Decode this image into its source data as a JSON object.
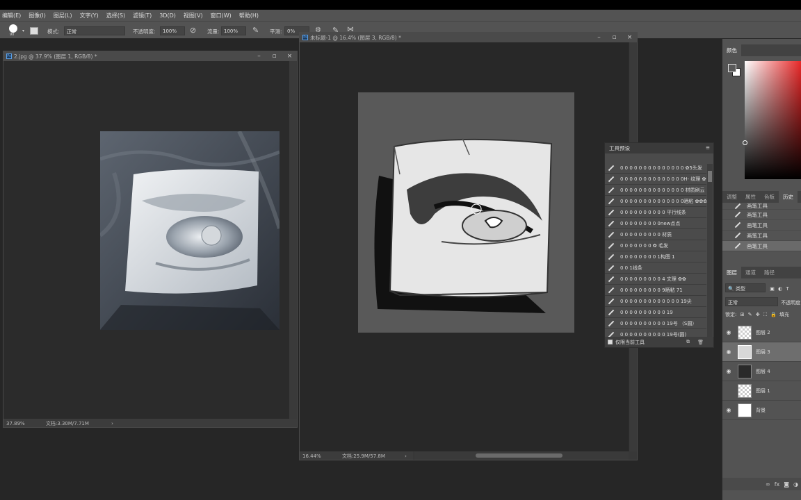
{
  "menu": [
    "编辑(E)",
    "图像(I)",
    "图层(L)",
    "文字(Y)",
    "选择(S)",
    "滤镜(T)",
    "3D(D)",
    "视图(V)",
    "窗口(W)",
    "帮助(H)"
  ],
  "options": {
    "brush_size": "90",
    "mode_label": "模式:",
    "mode_value": "正常",
    "opacity_label": "不透明度:",
    "opacity_value": "100%",
    "flow_label": "流量:",
    "flow_value": "100%",
    "smooth_label": "平滑:",
    "smooth_value": "0%"
  },
  "doc1": {
    "title": "2.jpg @ 37.9% (图层 1, RGB/8) *",
    "zoom": "37.89%",
    "docinfo": "文档:3.30M/7.71M"
  },
  "doc2": {
    "title": "未标题-1 @ 16.4% (图层 3, RGB/8) *",
    "zoom": "16.44%",
    "docinfo": "文档:25.9M/57.8M"
  },
  "presets": {
    "title": "工具预设",
    "items": [
      "0 0 0 0 0 0 0 0 0 0 0 0 0 0 ✿5头发",
      "0 0 0 0 0 0 0 0 0 0 0 0 0 0H- 纹理 ✿✿✿",
      "0 0 0 0 0 0 0 0 0 0 0 0 0 0 材质刷云",
      "0 0 0 0 0 0 0 0 0 0 0 0 0 0晒粘 ✿✿✿✿",
      "0 0 0 0 0 0 0 0 0 0 平行线条",
      "0 0 0 0 0 0 0 0 0new点点",
      "0 0 0 0 0 0 0 0 0 材质",
      "0 0 0 0 0 0 0 ✿ 毛发",
      "0 0 0 0 0 0 0 0 1构图 1",
      "0 0 1线条",
      "0 0 0 0 0 0 0 0 0 4 文理 ✿✿",
      "0 0 0 0 0 0 0 0 0 9晒粘 71",
      "0 0 0 0 0 0 0 0 0 0 0 0 0 19尖",
      "0 0 0 0 0 0 0 0 0 0 19",
      "0 0 0 0 0 0 0 0 0 0 19号 （S圆）",
      "0 0 0 0 0 0 0 0 0 0 19号(圆)"
    ],
    "footer": "仅限当前工具"
  },
  "panels": {
    "color_tab": "颜色",
    "mid_tabs": [
      "调整",
      "属性",
      "色板",
      "历史"
    ],
    "history_items": [
      "画笔工具",
      "画笔工具",
      "画笔工具",
      "画笔工具",
      "画笔工具"
    ],
    "layer_tabs": [
      "图层",
      "通道",
      "路径"
    ],
    "kind_label": "类型",
    "blend_mode": "正常",
    "opacity_label": "不透明度",
    "lock_label": "锁定:",
    "fill_label": "填充",
    "layers": [
      "图层 2",
      "图层 3",
      "图层 4",
      "图层 1",
      "背景"
    ]
  }
}
